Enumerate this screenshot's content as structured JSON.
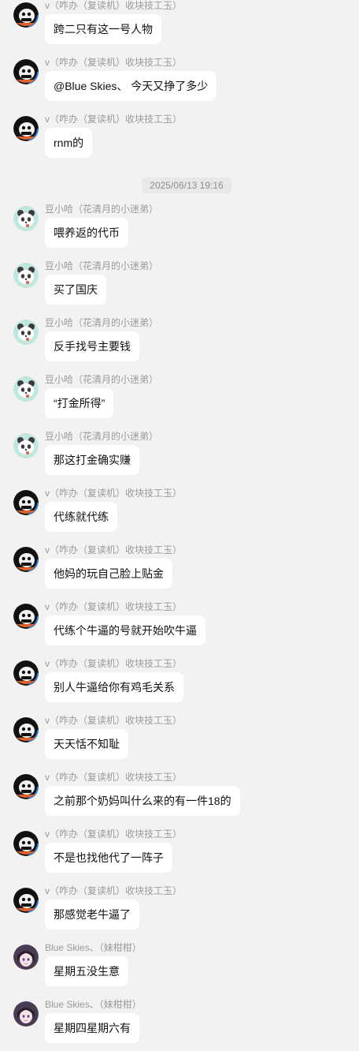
{
  "senders": {
    "v": "v（咋办（复读机）收块技工玉）",
    "dou": "豆小哈（花清月的小迷弟）",
    "blue": "Blue Skies、（妹柑柑）"
  },
  "timestamp": "2025/06/13 19:16",
  "messages": [
    {
      "sender": "v",
      "avatar": "dark-character-avatar-icon",
      "text": "跨二只有这一号人物"
    },
    {
      "sender": "v",
      "avatar": "dark-character-avatar-icon",
      "text": "@Blue Skies、 今天又挣了多少"
    },
    {
      "sender": "v",
      "avatar": "dark-character-avatar-icon",
      "text": "rnm的"
    },
    {
      "sender": "dou",
      "avatar": "panda-avatar-icon",
      "text": "喂养返的代币"
    },
    {
      "sender": "dou",
      "avatar": "panda-avatar-icon",
      "text": "买了国庆"
    },
    {
      "sender": "dou",
      "avatar": "panda-avatar-icon",
      "text": "反手找号主要钱"
    },
    {
      "sender": "dou",
      "avatar": "panda-avatar-icon",
      "text": "“打金所得”"
    },
    {
      "sender": "dou",
      "avatar": "panda-avatar-icon",
      "text": "那这打金确实赚"
    },
    {
      "sender": "v",
      "avatar": "dark-character-avatar-icon",
      "text": "代练就代练"
    },
    {
      "sender": "v",
      "avatar": "dark-character-avatar-icon",
      "text": "他妈的玩自己脸上贴金"
    },
    {
      "sender": "v",
      "avatar": "dark-character-avatar-icon",
      "text": "代练个牛逼的号就开始吹牛逼"
    },
    {
      "sender": "v",
      "avatar": "dark-character-avatar-icon",
      "text": "别人牛逼给你有鸡毛关系"
    },
    {
      "sender": "v",
      "avatar": "dark-character-avatar-icon",
      "text": "天天恬不知耻"
    },
    {
      "sender": "v",
      "avatar": "dark-character-avatar-icon",
      "text": "之前那个奶妈叫什么来的有一件18的"
    },
    {
      "sender": "v",
      "avatar": "dark-character-avatar-icon",
      "text": "不是也找他代了一阵子"
    },
    {
      "sender": "v",
      "avatar": "dark-character-avatar-icon",
      "text": "那感觉老牛逼了"
    },
    {
      "sender": "blue",
      "avatar": "anime-girl-avatar-icon",
      "text": "星期五没生意"
    },
    {
      "sender": "blue",
      "avatar": "anime-girl-avatar-icon",
      "text": "星期四星期六有"
    }
  ],
  "colors": {
    "background": "#f2f2f2",
    "bubble": "#ffffff",
    "sender_name": "#9a9a9a",
    "message_text": "#111111",
    "timestamp_bg": "#e8e8e8"
  }
}
